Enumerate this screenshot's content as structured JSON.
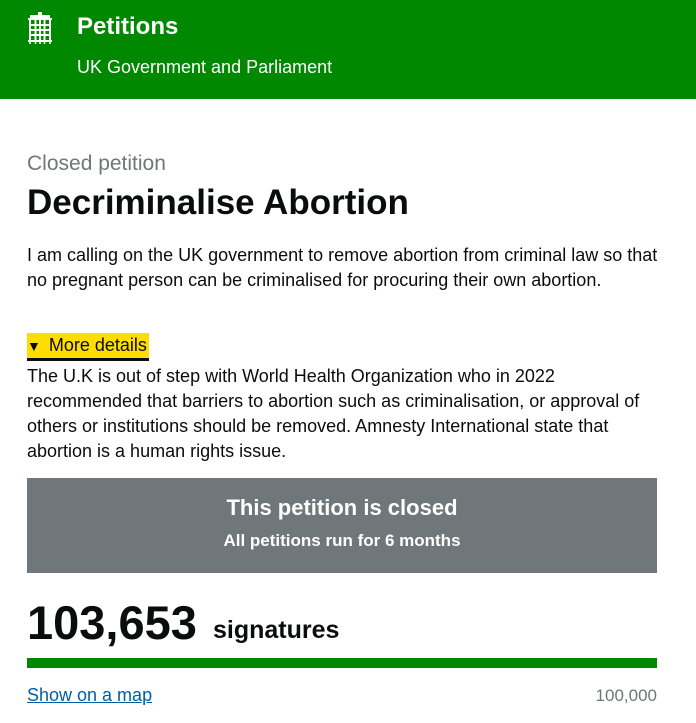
{
  "header": {
    "brand": "Petitions",
    "subtitle": "UK Government and Parliament",
    "logo_icon": "portcullis-icon"
  },
  "petition": {
    "status_caption": "Closed petition",
    "title": "Decriminalise Abortion",
    "summary": "I am calling on the UK government to remove abortion from criminal law so that no pregnant person can be criminalised for procuring their own abortion.",
    "details_toggle_label": "More details",
    "details_toggle_icon": "triangle-down-icon",
    "details_text": "The U.K is out of step with World Health Organization who in 2022 recommended that barriers to abortion such as criminalisation, or approval of others or institutions should be removed. Amnesty International state that abortion is a human rights issue."
  },
  "closed_notice": {
    "title": "This petition is closed",
    "subtitle": "All petitions run for 6 months"
  },
  "signatures": {
    "count": "103,653",
    "label": "signatures",
    "progress_fraction": 1.0,
    "map_link": "Show on a map",
    "threshold": "100,000"
  },
  "colors": {
    "brand_green": "#008800",
    "closed_panel_grey": "#6f777b",
    "focus_yellow": "#ffdd00",
    "link_blue": "#005ea5"
  }
}
